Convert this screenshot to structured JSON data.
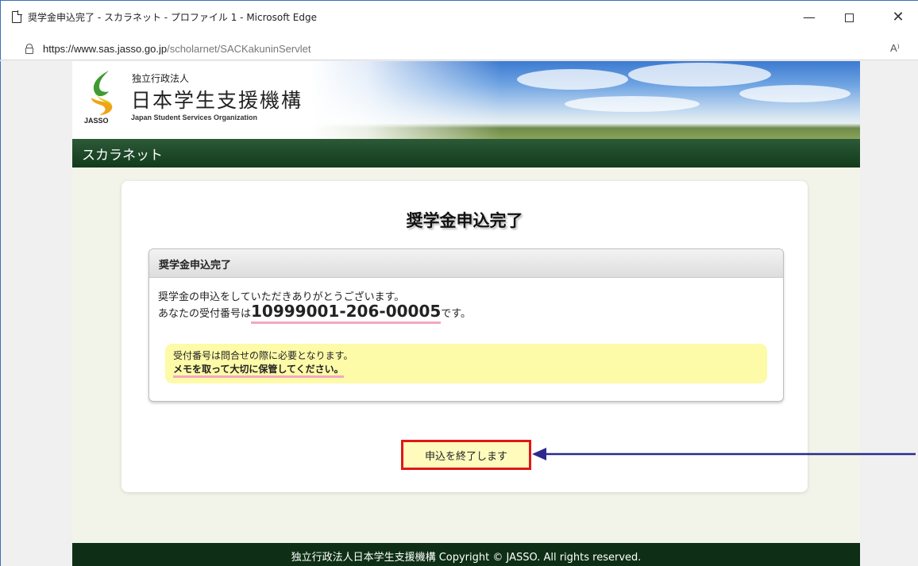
{
  "window": {
    "title": "奨学金申込完了 - スカラネット - プロファイル 1 - Microsoft Edge",
    "minimize": "—",
    "close": "✕"
  },
  "address": {
    "host": "https://www.sas.jasso.go.jp",
    "path": "/scholarnet/SACKakuninServlet",
    "read_aloud": "A⁾"
  },
  "header": {
    "org_small": "独立行政法人",
    "org_name": "日本学生支援機構",
    "org_en": "Japan Student Services Organization",
    "logo_text": "JASSO"
  },
  "nav": {
    "site_name": "スカラネット"
  },
  "main": {
    "title": "奨学金申込完了",
    "box_title": "奨学金申込完了",
    "message_line1": "奨学金の申込をしていただきありがとうございます。",
    "message_line2_prefix": "あなたの受付番号は",
    "receipt_number": "10999001-206-00005",
    "message_line2_suffix": "です。",
    "note_line1": "受付番号は問合せの際に必要となります。",
    "note_line2": "メモを取って大切に保管してください。",
    "finish_button": "申込を終了します"
  },
  "footer": {
    "copyright": "独立行政法人日本学生支援機構 Copyright © JASSO. All rights reserved."
  },
  "colors": {
    "nav_green": "#123a1c",
    "highlight_yellow": "#fdfaa8",
    "callout_red": "#e01818",
    "arrow_blue": "#2b2a8c"
  }
}
